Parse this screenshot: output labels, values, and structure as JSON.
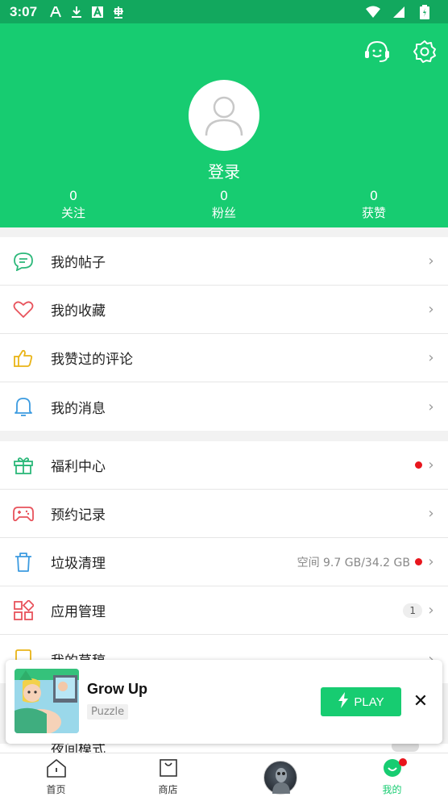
{
  "status_bar": {
    "time": "3:07",
    "left_icons": [
      "font-a-icon",
      "download-icon",
      "app-a-icon",
      "ghost-icon"
    ],
    "right_icons": [
      "wifi-icon",
      "signal-icon",
      "battery-icon"
    ]
  },
  "header": {
    "support_icon": "headset-icon",
    "settings_icon": "gear-icon",
    "login_label": "登录",
    "stats": [
      {
        "value": "0",
        "label": "关注"
      },
      {
        "value": "0",
        "label": "粉丝"
      },
      {
        "value": "0",
        "label": "获赞"
      }
    ]
  },
  "menu_group1": [
    {
      "icon": "chat-bubble-icon",
      "label": "我的帖子"
    },
    {
      "icon": "heart-icon",
      "label": "我的收藏"
    },
    {
      "icon": "thumbs-up-icon",
      "label": "我赞过的评论"
    },
    {
      "icon": "bell-icon",
      "label": "我的消息"
    }
  ],
  "menu_group2": [
    {
      "icon": "gift-icon",
      "label": "福利中心"
    },
    {
      "icon": "gamepad-icon",
      "label": "预约记录"
    },
    {
      "icon": "trash-icon",
      "label": "垃圾清理",
      "info": "空间 9.7 GB/34.2 GB"
    },
    {
      "icon": "apps-grid-icon",
      "label": "应用管理",
      "badge": "1"
    },
    {
      "icon": "draft-icon",
      "label": "我的草稿"
    }
  ],
  "peek_row": {
    "label": "夜间模式"
  },
  "ad": {
    "title": "Grow Up",
    "tag": "Puzzle",
    "play_label": "PLAY",
    "close": "✕"
  },
  "bottom_nav": [
    {
      "icon": "home-icon",
      "label": "首页"
    },
    {
      "icon": "shop-bag-icon",
      "label": "商店"
    },
    {
      "icon": "game-avatar",
      "label": ""
    },
    {
      "icon": "smile-icon",
      "label": "我的"
    }
  ],
  "colors": {
    "primary": "#17cc71",
    "statusbar": "#12a85e",
    "alert": "#e8161d"
  },
  "chevron": "›"
}
